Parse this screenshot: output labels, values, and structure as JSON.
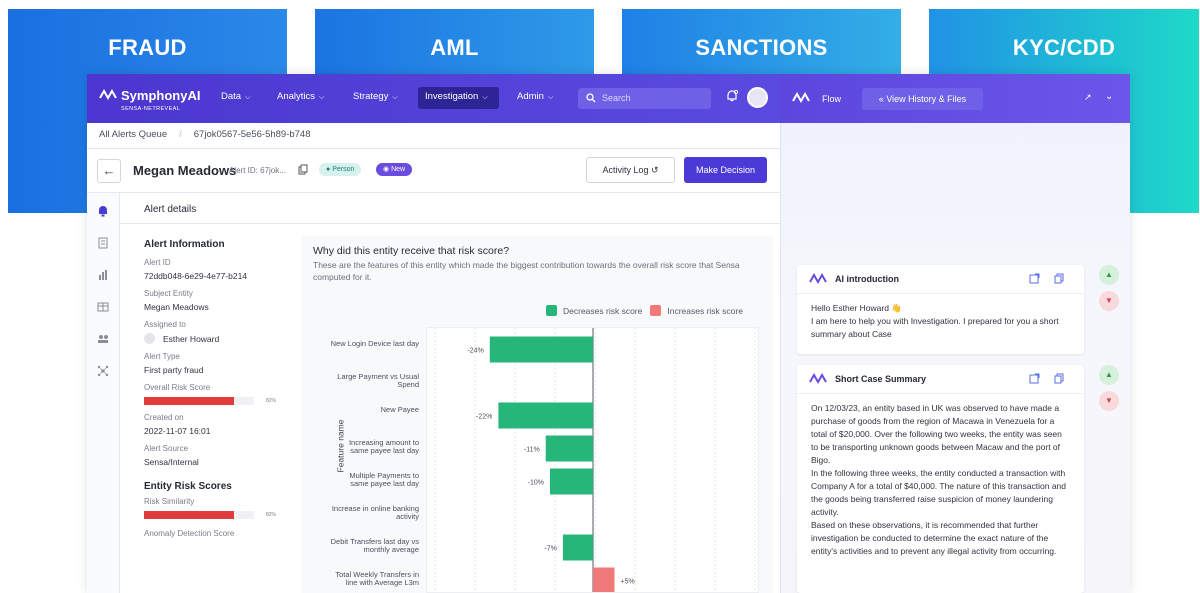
{
  "banners": [
    "FRAUD",
    "AML",
    "SANCTIONS",
    "KYC/CDD"
  ],
  "app": {
    "logo": {
      "name": "SymphonyAI",
      "sub": "SENSA-NETREVEAL"
    },
    "nav": [
      {
        "label": "Data"
      },
      {
        "label": "Analytics"
      },
      {
        "label": "Strategy"
      },
      {
        "label": "Investigation"
      },
      {
        "label": "Admin"
      }
    ],
    "search_placeholder": "Search",
    "breadcrumb": {
      "root": "All Alerts Queue",
      "current": "67jok0567-5e56-5h89-b748"
    },
    "entity": {
      "name": "Megan Meadows",
      "alert_id_label": "Alert ID: 67jok...",
      "tag_person": "Person",
      "tag_new": "New"
    },
    "buttons": {
      "activity_log": "Activity Log",
      "make_decision": "Make Decision"
    },
    "section_title": "Alert details",
    "info": {
      "heading": "Alert Information",
      "alert_id_label": "Alert ID",
      "alert_id": "72ddb048-6e29-4e77-b214",
      "subject_label": "Subject Entity",
      "subject": "Megan Meadows",
      "assigned_label": "Assigned to",
      "assigned": "Esther Howard",
      "type_label": "Alert Type",
      "type": "First party fraud",
      "risk_label": "Overall Risk Score",
      "risk_pct": "82%",
      "risk_value": 0.82,
      "created_label": "Created on",
      "created": "2022-11-07 16:01",
      "source_label": "Alert Source",
      "source": "Sensa/Internal",
      "entity_scores_heading": "Entity Risk Scores",
      "similarity_label": "Risk Similarity",
      "similarity_pct": "82%",
      "similarity_value": 0.82,
      "anomaly_label": "Anomaly Detection Score"
    }
  },
  "card": {
    "title": "Why did this entity receive that risk score?",
    "subtitle": "These are the features of this entity which made the biggest contribution towards the overall risk score that Sensa computed for it."
  },
  "chart_data": {
    "type": "bar",
    "orientation": "horizontal",
    "ylabel": "Feature name",
    "legend": [
      {
        "name": "Decreases risk score",
        "color": "#27b67a"
      },
      {
        "name": "Increases risk score",
        "color": "#f07a7a"
      }
    ],
    "categories": [
      "New Login Device last day",
      "Large Payment vs Usual Spend",
      "New Payee",
      "Increasing amount to same payee last day",
      "Multiple Payments to same payee last day",
      "Increase in online banking activity",
      "Debit Transfers last day vs monthly average",
      "Total Weekly Transfers in line with Average L3m"
    ],
    "values": [
      -24,
      null,
      -22,
      -11,
      -10,
      null,
      -7,
      5
    ],
    "labels": [
      "-24%",
      "",
      "-22%",
      "-11%",
      "-10%",
      "",
      "-7%",
      "+5%"
    ],
    "xlim": [
      -40,
      40
    ],
    "grid": true
  },
  "flow": {
    "title": "Flow",
    "history_button": "View History & Files",
    "messages": [
      {
        "title": "AI introduction",
        "body": "Hello Esther Howard 👋\nI am here to help you with Investigation. I prepared for you a short summary about Case"
      },
      {
        "title": "Short Case Summary",
        "body": "On 12/03/23, an entity based in UK was observed to have made a purchase of goods from the region of Macawa in Venezuela for a total of $20,000. Over the following two weeks, the entity was seen to be transporting unknown goods between Macaw and the port of Bigo.\nIn the following three weeks, the entity conducted a transaction with Company A for a total of $40,000. The nature of this transaction and the goods being transferred raise suspicion of money laundering activity.\nBased on these observations, it is recommended that further investigation be conducted to determine the exact nature of the entity's activities and to prevent any illegal activity from occurring."
      }
    ]
  },
  "colors": {
    "primary": "#4b3ad6",
    "danger": "#e23b3b",
    "decrease": "#27b67a",
    "increase": "#f07a7a"
  }
}
